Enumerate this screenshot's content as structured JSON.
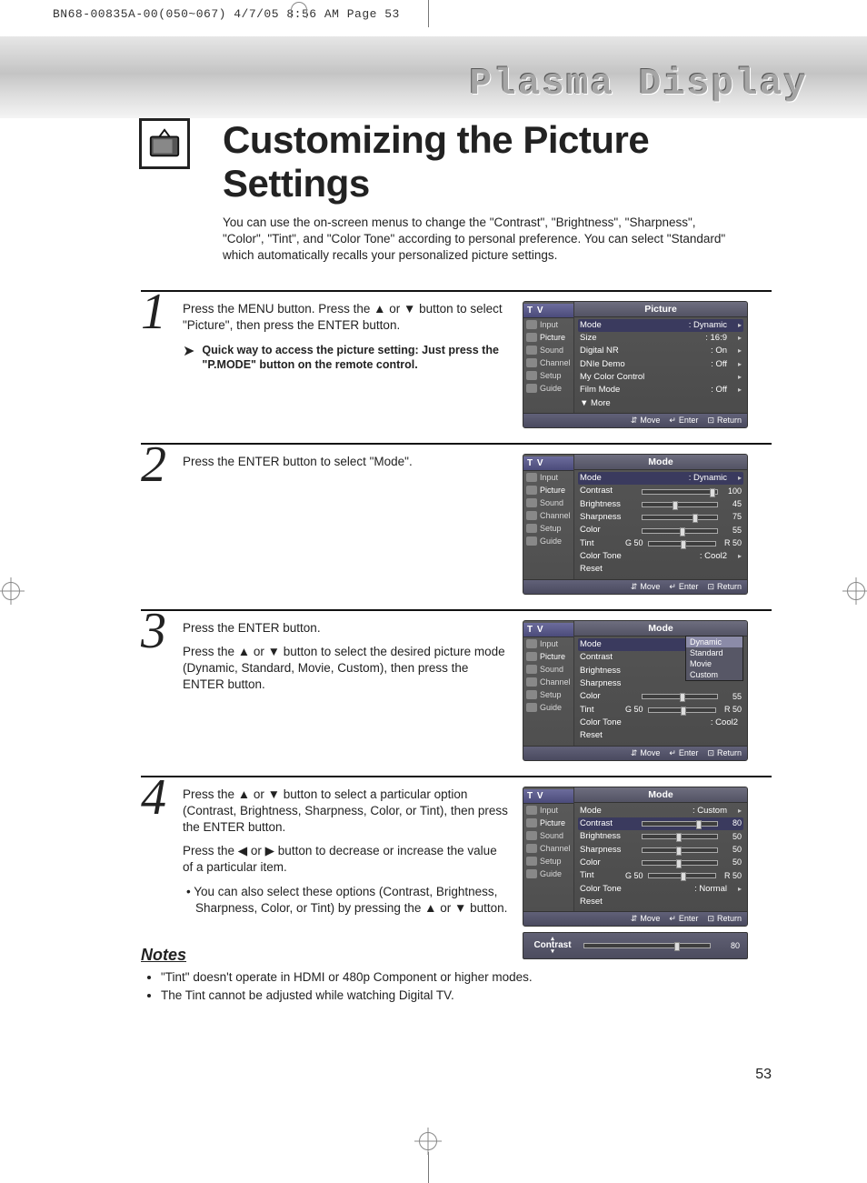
{
  "print_header": "BN68-00835A-00(050~067)  4/7/05  8:56 AM  Page 53",
  "watermark": "Plasma Display",
  "title": "Customizing the Picture Settings",
  "intro": "You can use the on-screen menus to change the \"Contrast\", \"Brightness\", \"Sharpness\", \"Color\", \"Tint\", and \"Color Tone\" according to personal preference. You can select \"Standard\" which automatically recalls your personalized picture settings.",
  "steps": {
    "s1": {
      "num": "1",
      "text": "Press the MENU button. Press the ▲ or ▼ button to select \"Picture\", then press the ENTER button.",
      "tip": "Quick way to access the picture setting: Just press the \"P.MODE\" button on the remote control."
    },
    "s2": {
      "num": "2",
      "text": "Press the ENTER button to select \"Mode\"."
    },
    "s3": {
      "num": "3",
      "text": "Press the ENTER button.\nPress the ▲ or ▼ button to select the desired picture mode (Dynamic, Standard, Movie, Custom), then press the ENTER button."
    },
    "s4": {
      "num": "4",
      "text1": "Press the ▲ or ▼ button to select a particular option (Contrast, Brightness, Sharpness, Color, or Tint), then press the ENTER button.",
      "text2": "Press the ◀ or ▶ button to decrease or increase the value of a particular item.",
      "bullet": "You can also select these options (Contrast, Brightness, Sharpness, Color, or Tint) by pressing the ▲ or ▼ button."
    }
  },
  "osd_common": {
    "tv": "T V",
    "side": [
      "Input",
      "Picture",
      "Sound",
      "Channel",
      "Setup",
      "Guide"
    ],
    "foot_move": "Move",
    "foot_enter": "Enter",
    "foot_return": "Return"
  },
  "osd1": {
    "title": "Picture",
    "rows": [
      {
        "label": "Mode",
        "value": ": Dynamic",
        "arrow": true,
        "sel": true
      },
      {
        "label": "Size",
        "value": ": 16:9",
        "arrow": true
      },
      {
        "label": "Digital NR",
        "value": ": On",
        "arrow": true
      },
      {
        "label": "DNIe Demo",
        "value": ": Off",
        "arrow": true
      },
      {
        "label": "My Color Control",
        "value": "",
        "arrow": true
      },
      {
        "label": "Film Mode",
        "value": ": Off",
        "arrow": true
      },
      {
        "label": "▼ More",
        "value": "",
        "arrow": false
      }
    ]
  },
  "osd2": {
    "title": "Mode",
    "mode_value": ": Dynamic",
    "contrast": 100,
    "brightness": 45,
    "sharpness": 75,
    "color": 55,
    "tint_g": "G 50",
    "tint_r": "R 50",
    "color_tone": ": Cool2",
    "labels": {
      "mode": "Mode",
      "contrast": "Contrast",
      "brightness": "Brightness",
      "sharpness": "Sharpness",
      "color": "Color",
      "tint": "Tint",
      "colortone": "Color Tone",
      "reset": "Reset"
    }
  },
  "osd3": {
    "title": "Mode",
    "popup": [
      "Dynamic",
      "Standard",
      "Movie",
      "Custom"
    ],
    "popup_sel": "Dynamic",
    "color": 55,
    "tint_g": "G 50",
    "tint_r": "R 50",
    "color_tone": ": Cool2"
  },
  "osd4": {
    "title": "Mode",
    "mode_value": ": Custom",
    "contrast": 80,
    "brightness": 50,
    "sharpness": 50,
    "color": 50,
    "tint_g": "G 50",
    "tint_r": "R 50",
    "color_tone": ": Normal",
    "sel": "Contrast"
  },
  "osd_slim": {
    "label": "Contrast",
    "value": 80
  },
  "notes": {
    "heading": "Notes",
    "items": [
      "\"Tint\" doesn't operate in HDMI or 480p Component or higher modes.",
      "The Tint cannot be adjusted while watching Digital TV."
    ]
  },
  "page_number": "53"
}
